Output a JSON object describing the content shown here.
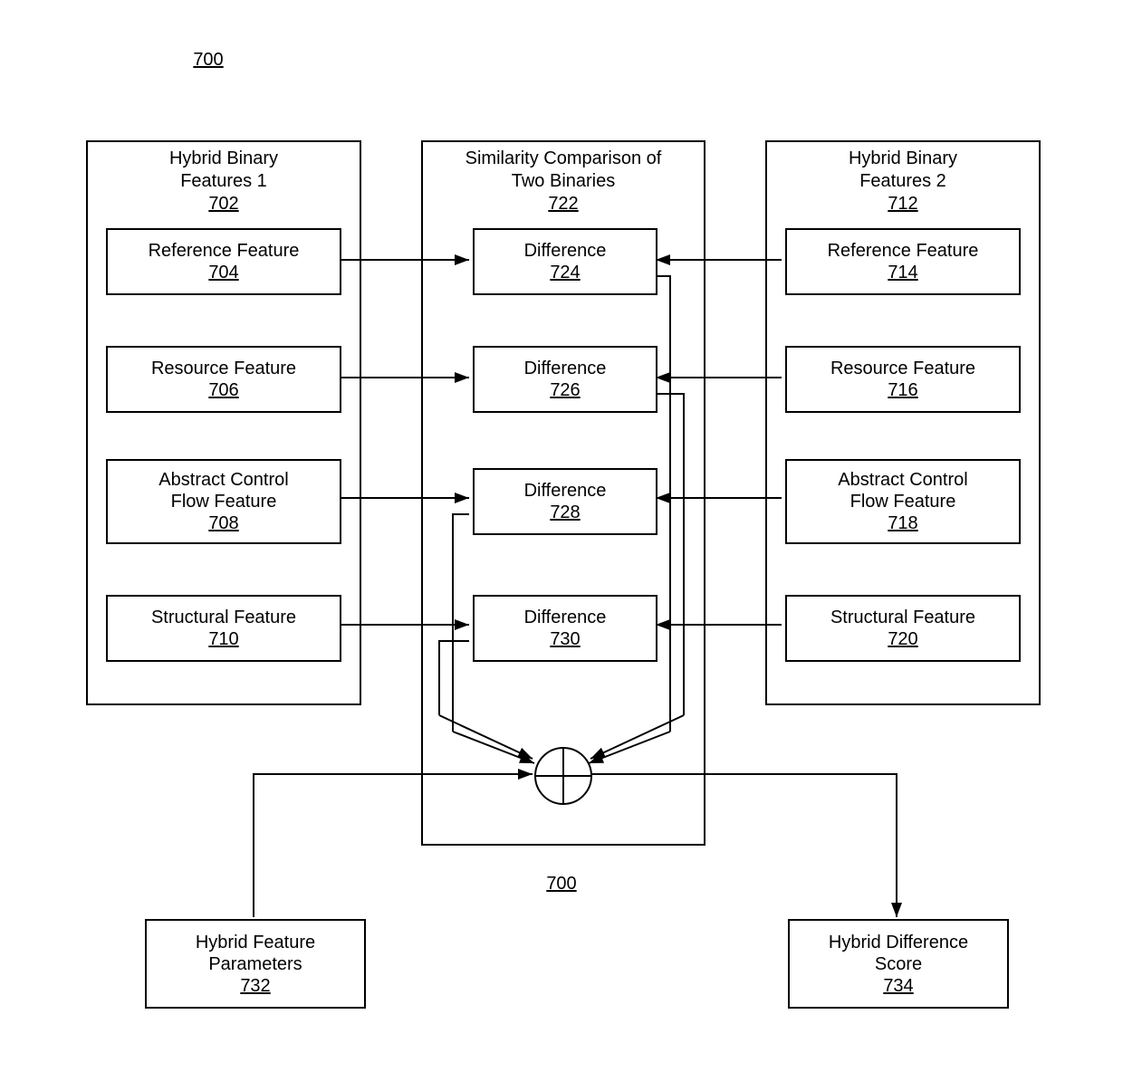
{
  "figure": {
    "topLabel": "700",
    "bottomLabel": "700"
  },
  "left": {
    "title": "Hybrid Binary\nFeatures 1",
    "num": "702",
    "items": [
      {
        "label": "Reference Feature",
        "num": "704"
      },
      {
        "label": "Resource Feature",
        "num": "706"
      },
      {
        "label": "Abstract Control\nFlow Feature",
        "num": "708"
      },
      {
        "label": "Structural Feature",
        "num": "710"
      }
    ]
  },
  "right": {
    "title": "Hybrid Binary\nFeatures 2",
    "num": "712",
    "items": [
      {
        "label": "Reference Feature",
        "num": "714"
      },
      {
        "label": "Resource Feature",
        "num": "716"
      },
      {
        "label": "Abstract Control\nFlow Feature",
        "num": "718"
      },
      {
        "label": "Structural Feature",
        "num": "720"
      }
    ]
  },
  "center": {
    "title": "Similarity Comparison of\nTwo Binaries",
    "num": "722",
    "items": [
      {
        "label": "Difference",
        "num": "724"
      },
      {
        "label": "Difference",
        "num": "726"
      },
      {
        "label": "Difference",
        "num": "728"
      },
      {
        "label": "Difference",
        "num": "730"
      }
    ]
  },
  "outputs": {
    "params": {
      "label": "Hybrid  Feature\nParameters",
      "num": "732"
    },
    "score": {
      "label": "Hybrid  Difference\nScore",
      "num": "734"
    }
  }
}
